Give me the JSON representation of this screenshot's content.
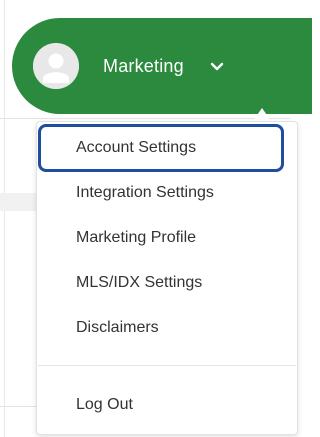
{
  "header": {
    "account_name": "Marketing",
    "avatar_icon": "user-avatar-icon",
    "toggle_icon": "chevron-down-icon",
    "accent_color": "#2b8a3e"
  },
  "dropdown": {
    "items": [
      {
        "label": "Account Settings",
        "focused": true
      },
      {
        "label": "Integration Settings"
      },
      {
        "label": "Marketing Profile"
      },
      {
        "label": "MLS/IDX Settings"
      },
      {
        "label": "Disclaimers"
      }
    ],
    "logout_label": "Log Out",
    "focus_color": "#1f4e9c"
  }
}
